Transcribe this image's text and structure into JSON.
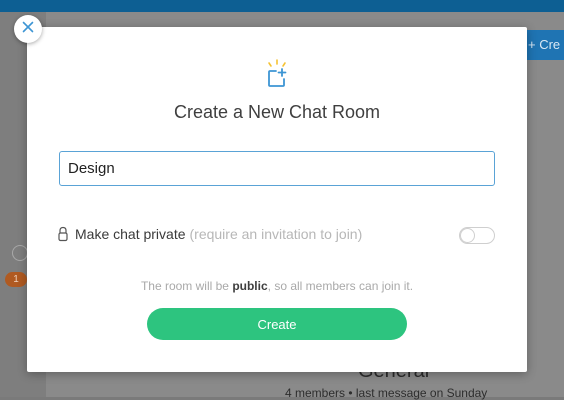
{
  "background": {
    "create_button_label": "+ Cre",
    "badge_count": "1",
    "channel_title": "General",
    "channel_meta": "4 members  •  last message on Sunday"
  },
  "modal": {
    "title": "Create a New Chat Room",
    "name_input": {
      "value": "Design",
      "placeholder": ""
    },
    "private_label": "Make chat private",
    "private_hint": "(require an invitation to join)",
    "private_enabled": false,
    "info_prefix": "The room will be ",
    "info_emphasis": "public",
    "info_suffix": ", so all members can join it.",
    "create_button_label": "Create"
  },
  "icons": {
    "close": "close-icon",
    "header": "chat-room-add-icon",
    "lock": "lock-icon"
  },
  "colors": {
    "accent_blue": "#5aa3d6",
    "create_green": "#2dc47f",
    "sparkle_yellow": "#f5c233",
    "top_bar": "#0d5f93"
  }
}
